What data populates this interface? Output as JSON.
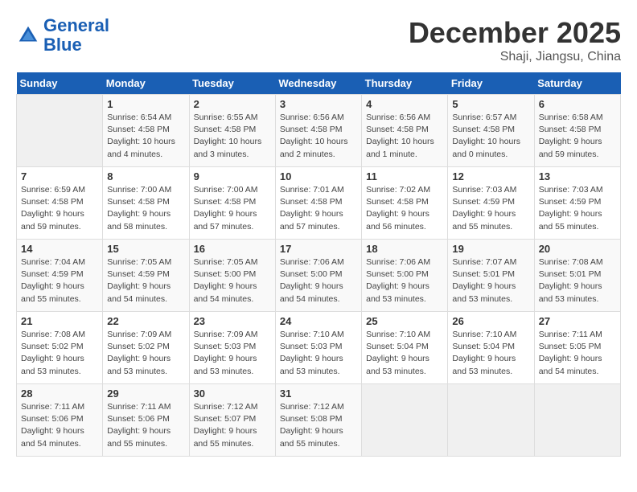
{
  "header": {
    "logo_line1": "General",
    "logo_line2": "Blue",
    "month": "December 2025",
    "location": "Shaji, Jiangsu, China"
  },
  "weekdays": [
    "Sunday",
    "Monday",
    "Tuesday",
    "Wednesday",
    "Thursday",
    "Friday",
    "Saturday"
  ],
  "weeks": [
    [
      {
        "day": "",
        "sunrise": "",
        "sunset": "",
        "daylight": ""
      },
      {
        "day": "1",
        "sunrise": "Sunrise: 6:54 AM",
        "sunset": "Sunset: 4:58 PM",
        "daylight": "Daylight: 10 hours and 4 minutes."
      },
      {
        "day": "2",
        "sunrise": "Sunrise: 6:55 AM",
        "sunset": "Sunset: 4:58 PM",
        "daylight": "Daylight: 10 hours and 3 minutes."
      },
      {
        "day": "3",
        "sunrise": "Sunrise: 6:56 AM",
        "sunset": "Sunset: 4:58 PM",
        "daylight": "Daylight: 10 hours and 2 minutes."
      },
      {
        "day": "4",
        "sunrise": "Sunrise: 6:56 AM",
        "sunset": "Sunset: 4:58 PM",
        "daylight": "Daylight: 10 hours and 1 minute."
      },
      {
        "day": "5",
        "sunrise": "Sunrise: 6:57 AM",
        "sunset": "Sunset: 4:58 PM",
        "daylight": "Daylight: 10 hours and 0 minutes."
      },
      {
        "day": "6",
        "sunrise": "Sunrise: 6:58 AM",
        "sunset": "Sunset: 4:58 PM",
        "daylight": "Daylight: 9 hours and 59 minutes."
      }
    ],
    [
      {
        "day": "7",
        "sunrise": "Sunrise: 6:59 AM",
        "sunset": "Sunset: 4:58 PM",
        "daylight": "Daylight: 9 hours and 59 minutes."
      },
      {
        "day": "8",
        "sunrise": "Sunrise: 7:00 AM",
        "sunset": "Sunset: 4:58 PM",
        "daylight": "Daylight: 9 hours and 58 minutes."
      },
      {
        "day": "9",
        "sunrise": "Sunrise: 7:00 AM",
        "sunset": "Sunset: 4:58 PM",
        "daylight": "Daylight: 9 hours and 57 minutes."
      },
      {
        "day": "10",
        "sunrise": "Sunrise: 7:01 AM",
        "sunset": "Sunset: 4:58 PM",
        "daylight": "Daylight: 9 hours and 57 minutes."
      },
      {
        "day": "11",
        "sunrise": "Sunrise: 7:02 AM",
        "sunset": "Sunset: 4:58 PM",
        "daylight": "Daylight: 9 hours and 56 minutes."
      },
      {
        "day": "12",
        "sunrise": "Sunrise: 7:03 AM",
        "sunset": "Sunset: 4:59 PM",
        "daylight": "Daylight: 9 hours and 55 minutes."
      },
      {
        "day": "13",
        "sunrise": "Sunrise: 7:03 AM",
        "sunset": "Sunset: 4:59 PM",
        "daylight": "Daylight: 9 hours and 55 minutes."
      }
    ],
    [
      {
        "day": "14",
        "sunrise": "Sunrise: 7:04 AM",
        "sunset": "Sunset: 4:59 PM",
        "daylight": "Daylight: 9 hours and 55 minutes."
      },
      {
        "day": "15",
        "sunrise": "Sunrise: 7:05 AM",
        "sunset": "Sunset: 4:59 PM",
        "daylight": "Daylight: 9 hours and 54 minutes."
      },
      {
        "day": "16",
        "sunrise": "Sunrise: 7:05 AM",
        "sunset": "Sunset: 5:00 PM",
        "daylight": "Daylight: 9 hours and 54 minutes."
      },
      {
        "day": "17",
        "sunrise": "Sunrise: 7:06 AM",
        "sunset": "Sunset: 5:00 PM",
        "daylight": "Daylight: 9 hours and 54 minutes."
      },
      {
        "day": "18",
        "sunrise": "Sunrise: 7:06 AM",
        "sunset": "Sunset: 5:00 PM",
        "daylight": "Daylight: 9 hours and 53 minutes."
      },
      {
        "day": "19",
        "sunrise": "Sunrise: 7:07 AM",
        "sunset": "Sunset: 5:01 PM",
        "daylight": "Daylight: 9 hours and 53 minutes."
      },
      {
        "day": "20",
        "sunrise": "Sunrise: 7:08 AM",
        "sunset": "Sunset: 5:01 PM",
        "daylight": "Daylight: 9 hours and 53 minutes."
      }
    ],
    [
      {
        "day": "21",
        "sunrise": "Sunrise: 7:08 AM",
        "sunset": "Sunset: 5:02 PM",
        "daylight": "Daylight: 9 hours and 53 minutes."
      },
      {
        "day": "22",
        "sunrise": "Sunrise: 7:09 AM",
        "sunset": "Sunset: 5:02 PM",
        "daylight": "Daylight: 9 hours and 53 minutes."
      },
      {
        "day": "23",
        "sunrise": "Sunrise: 7:09 AM",
        "sunset": "Sunset: 5:03 PM",
        "daylight": "Daylight: 9 hours and 53 minutes."
      },
      {
        "day": "24",
        "sunrise": "Sunrise: 7:10 AM",
        "sunset": "Sunset: 5:03 PM",
        "daylight": "Daylight: 9 hours and 53 minutes."
      },
      {
        "day": "25",
        "sunrise": "Sunrise: 7:10 AM",
        "sunset": "Sunset: 5:04 PM",
        "daylight": "Daylight: 9 hours and 53 minutes."
      },
      {
        "day": "26",
        "sunrise": "Sunrise: 7:10 AM",
        "sunset": "Sunset: 5:04 PM",
        "daylight": "Daylight: 9 hours and 53 minutes."
      },
      {
        "day": "27",
        "sunrise": "Sunrise: 7:11 AM",
        "sunset": "Sunset: 5:05 PM",
        "daylight": "Daylight: 9 hours and 54 minutes."
      }
    ],
    [
      {
        "day": "28",
        "sunrise": "Sunrise: 7:11 AM",
        "sunset": "Sunset: 5:06 PM",
        "daylight": "Daylight: 9 hours and 54 minutes."
      },
      {
        "day": "29",
        "sunrise": "Sunrise: 7:11 AM",
        "sunset": "Sunset: 5:06 PM",
        "daylight": "Daylight: 9 hours and 55 minutes."
      },
      {
        "day": "30",
        "sunrise": "Sunrise: 7:12 AM",
        "sunset": "Sunset: 5:07 PM",
        "daylight": "Daylight: 9 hours and 55 minutes."
      },
      {
        "day": "31",
        "sunrise": "Sunrise: 7:12 AM",
        "sunset": "Sunset: 5:08 PM",
        "daylight": "Daylight: 9 hours and 55 minutes."
      },
      {
        "day": "",
        "sunrise": "",
        "sunset": "",
        "daylight": ""
      },
      {
        "day": "",
        "sunrise": "",
        "sunset": "",
        "daylight": ""
      },
      {
        "day": "",
        "sunrise": "",
        "sunset": "",
        "daylight": ""
      }
    ]
  ]
}
